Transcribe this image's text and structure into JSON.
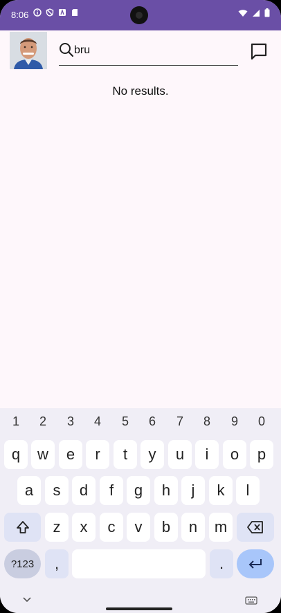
{
  "status_bar": {
    "time": "8:06"
  },
  "header": {
    "search_value": "bru"
  },
  "results": {
    "message": "No results."
  },
  "keyboard": {
    "number_row": [
      "1",
      "2",
      "3",
      "4",
      "5",
      "6",
      "7",
      "8",
      "9",
      "0"
    ],
    "row1": [
      "q",
      "w",
      "e",
      "r",
      "t",
      "y",
      "u",
      "i",
      "o",
      "p"
    ],
    "row2": [
      "a",
      "s",
      "d",
      "f",
      "g",
      "h",
      "j",
      "k",
      "l"
    ],
    "row3": [
      "z",
      "x",
      "c",
      "v",
      "b",
      "n",
      "m"
    ],
    "symbols_label": "?123",
    "comma_label": ",",
    "period_label": "."
  }
}
